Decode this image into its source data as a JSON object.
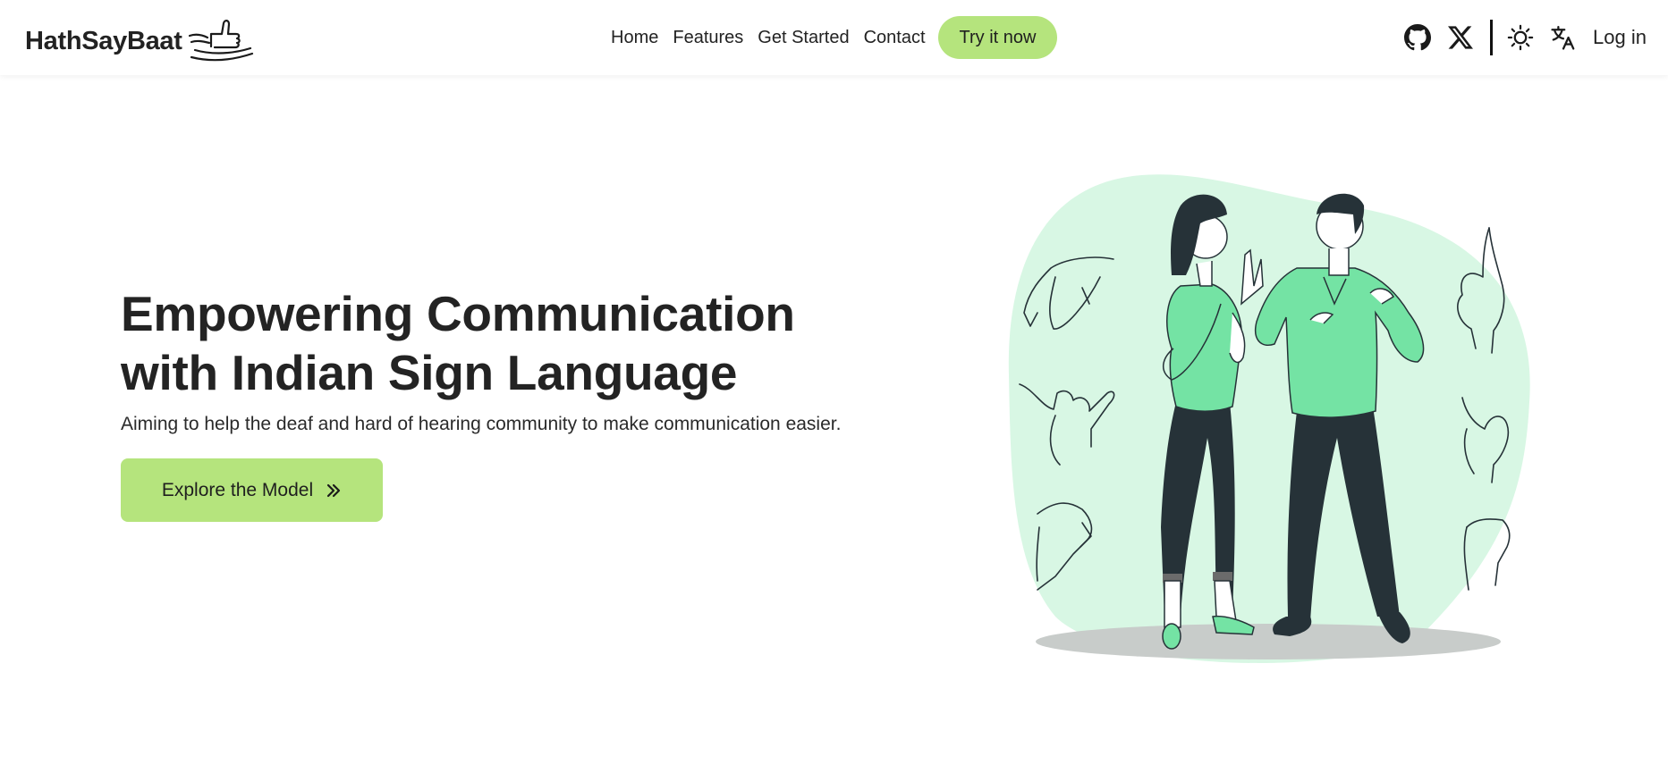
{
  "brand": {
    "name": "HathSayBaat",
    "logo_icon": "thumbs-up-hand-logo"
  },
  "nav": {
    "links": [
      "Home",
      "Features",
      "Get Started",
      "Contact"
    ],
    "cta_label": "Try it now"
  },
  "nav_right": {
    "icons": [
      "github-icon",
      "x-twitter-icon",
      "sun-theme-icon",
      "translate-icon"
    ],
    "login_label": "Log in"
  },
  "hero": {
    "title_line1": "Empowering Communication",
    "title_line2": "with Indian Sign Language",
    "subtitle": "Aiming to help the deaf and hard of hearing community to make communication easier.",
    "cta_label": "Explore the Model",
    "cta_icon": "double-chevron-right-icon",
    "illustration": "two-people-signing-illustration"
  },
  "colors": {
    "accent": "#b5e47d",
    "illustration_blob": "#d8f7e4",
    "shirt_green": "#74e3a4",
    "pants_dark": "#263238"
  }
}
